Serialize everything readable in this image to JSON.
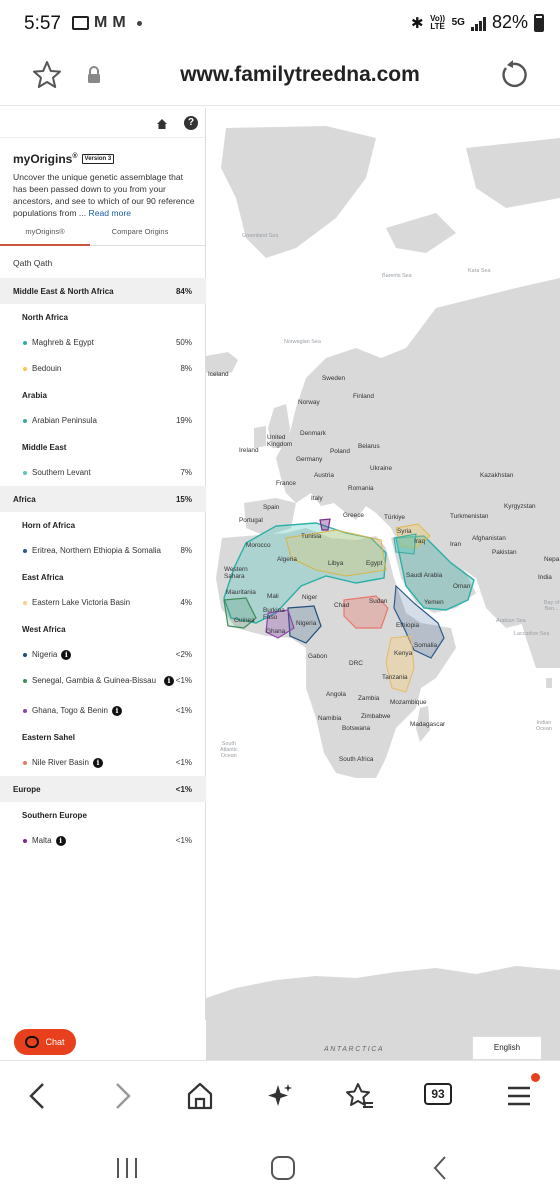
{
  "status": {
    "time": "5:57",
    "network": "5G",
    "volte": "Vo)) LTE",
    "battery": "82%"
  },
  "browser": {
    "url": "www.familytreedna.com",
    "tabs_count": "93"
  },
  "sidebar": {
    "title": "myOrigins",
    "trademark": "®",
    "version_badge": "Version 3",
    "description": "Uncover the unique genetic assemblage that has been passed down to you from your ancestors, and see to which of our 90 reference populations from ...",
    "read_more": "Read more",
    "tabs": [
      {
        "label": "myOrigins®"
      },
      {
        "label": "Compare Origins"
      }
    ],
    "user_name": "Qath Qath"
  },
  "origins": {
    "mena": {
      "name": "Middle East & North Africa",
      "pct": "84%"
    },
    "north_africa": {
      "name": "North Africa"
    },
    "maghreb": {
      "name": "Maghreb & Egypt",
      "pct": "50%",
      "color": "#2bb0a8"
    },
    "bedouin": {
      "name": "Bedouin",
      "pct": "8%",
      "color": "#f2c94c"
    },
    "arabia": {
      "name": "Arabia"
    },
    "arabian_peninsula": {
      "name": "Arabian Peninsula",
      "pct": "19%",
      "color": "#3aa99f"
    },
    "middle_east": {
      "name": "Middle East"
    },
    "southern_levant": {
      "name": "Southern Levant",
      "pct": "7%",
      "color": "#5bc8c0"
    },
    "africa": {
      "name": "Africa",
      "pct": "15%"
    },
    "horn_of_africa": {
      "name": "Horn of Africa"
    },
    "eritrea": {
      "name": "Eritrea, Northern Ethiopia & Somalia",
      "pct": "8%",
      "color": "#2d5a8a"
    },
    "east_africa": {
      "name": "East Africa"
    },
    "lake_victoria": {
      "name": "Eastern Lake Victoria Basin",
      "pct": "4%",
      "color": "#f5d08a"
    },
    "west_africa": {
      "name": "West Africa"
    },
    "nigeria": {
      "name": "Nigeria",
      "pct": "<2%",
      "color": "#1f4f7a"
    },
    "senegal": {
      "name": "Senegal, Gambia & Guinea-Bissau",
      "pct": "<1%",
      "color": "#3c8d5a"
    },
    "ghana": {
      "name": "Ghana, Togo & Benin",
      "pct": "<1%",
      "color": "#8e44ad"
    },
    "eastern_sahel": {
      "name": "Eastern Sahel"
    },
    "nile_river": {
      "name": "Nile River Basin",
      "pct": "<1%",
      "color": "#e8776b"
    },
    "europe": {
      "name": "Europe",
      "pct": "<1%"
    },
    "southern_europe": {
      "name": "Southern Europe"
    },
    "malta": {
      "name": "Malta",
      "pct": "<1%",
      "color": "#7b2d8e"
    }
  },
  "map": {
    "labels": {
      "sweden": "Sweden",
      "finland": "Finland",
      "norway": "Norway",
      "iceland": "Iceland",
      "uk": "United\nKingdom",
      "denmark": "Denmark",
      "ireland": "Ireland",
      "germany": "Germany",
      "poland": "Poland",
      "belarus": "Belarus",
      "ukraine": "Ukraine",
      "france": "France",
      "austria": "Austria",
      "romania": "Romania",
      "italy": "Italy",
      "kazakhstan": "Kazakhstan",
      "spain": "Spain",
      "portugal": "Portugal",
      "greece": "Greece",
      "turkiye": "Türkiye",
      "turkmenistan": "Turkmenistan",
      "kyrgyzstan": "Kyrgyzstan",
      "tunisia": "Tunisia",
      "syria": "Syria",
      "iraq": "Iraq",
      "iran": "Iran",
      "afghanistan": "Afghanistan",
      "pakistan": "Pakistan",
      "nepal": "Nepa",
      "morocco": "Morocco",
      "algeria": "Algeria",
      "libya": "Libya",
      "egypt": "Egypt",
      "saudi": "Saudi Arabia",
      "oman": "Oman",
      "india": "India",
      "western_sahara": "Western\nSahara",
      "mauritania": "Mauritania",
      "mali": "Mali",
      "niger": "Niger",
      "chad": "Chad",
      "sudan": "Sudan",
      "yemen": "Yemen",
      "burkina": "Burkina\nFaso",
      "guinea": "Guinea",
      "nigeria": "Nigeria",
      "ethiopia": "Ethiopia",
      "somalia": "Somalia",
      "ghana": "Ghana",
      "gabon": "Gabon",
      "drc": "DRC",
      "kenya": "Kenya",
      "tanzania": "Tanzania",
      "angola": "Angola",
      "zambia": "Zambia",
      "mozambique": "Mozambique",
      "namibia": "Namibia",
      "zimbabwe": "Zimbabwe",
      "botswana": "Botswana",
      "madagascar": "Madagascar",
      "south_africa": "South Africa"
    },
    "oceans": {
      "greenland_sea": "Greenland Sea",
      "barents_sea": "Barents Sea",
      "norwegian_sea": "Norwegian Sea",
      "kara_sea": "Kara Sea",
      "arabian_sea": "Arabian Sea",
      "laccadive_sea": "Laccadive Sea",
      "south_atlantic": "South\nAtlantic\nOcean",
      "indian_ocean": "Indian\nOcean",
      "bay_bengal": "Bay of\nBen..."
    },
    "antarctica": "ANTARCTICA",
    "language": "English"
  },
  "chat": {
    "label": "Chat"
  }
}
